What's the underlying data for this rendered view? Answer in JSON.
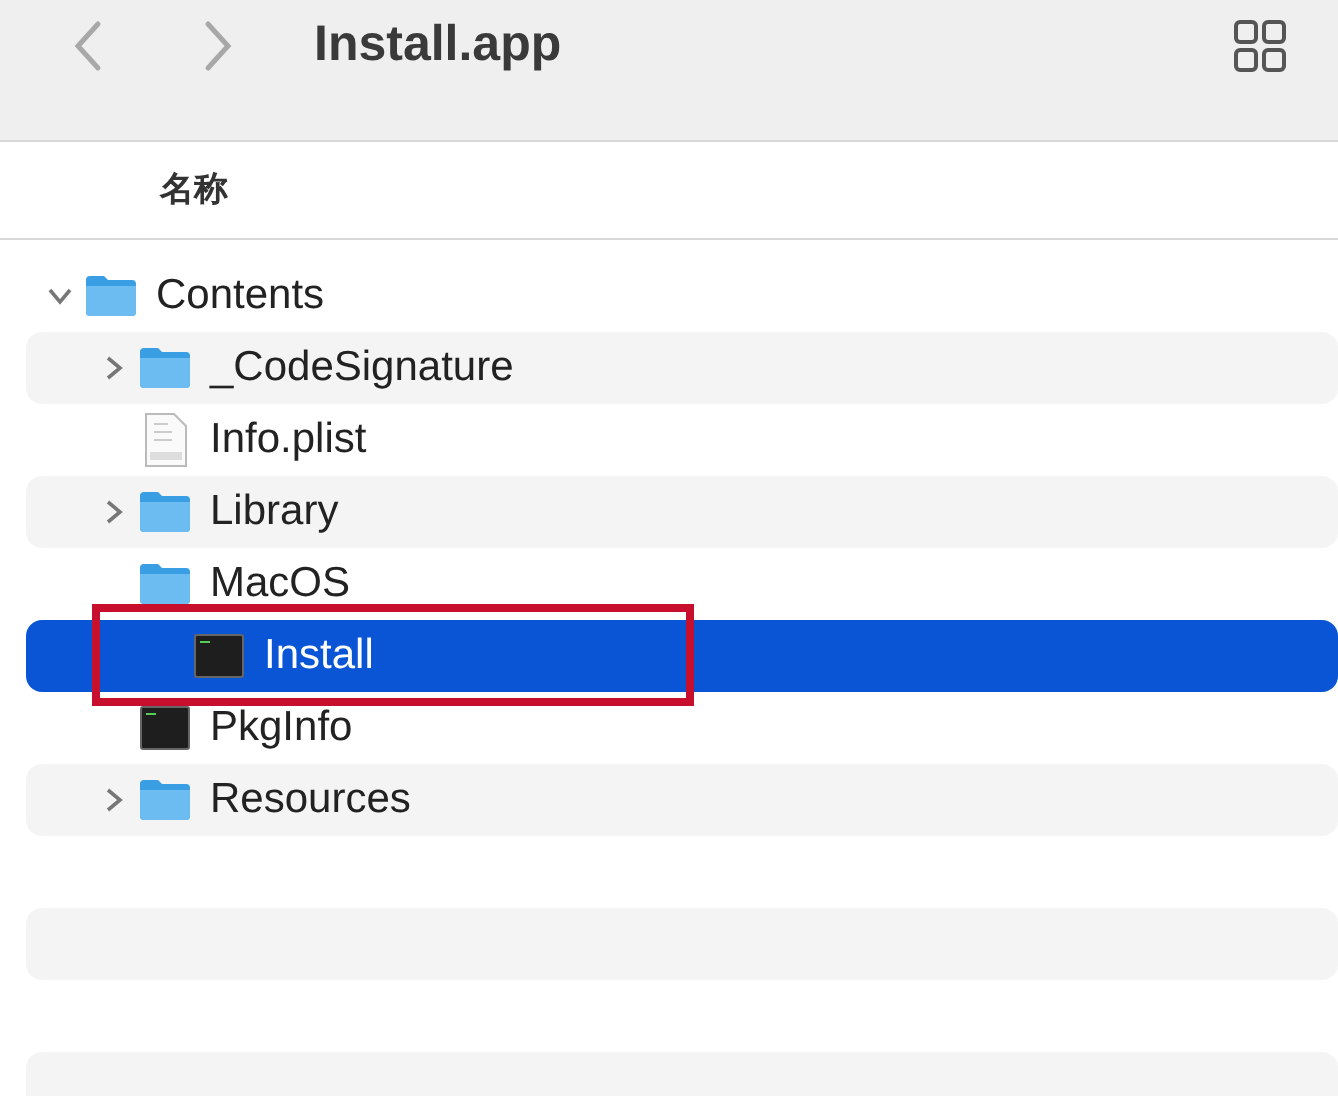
{
  "toolbar": {
    "title": "Install.app"
  },
  "column_header": "名称",
  "tree": [
    {
      "name": "Contents",
      "kind": "folder",
      "expanded": true,
      "selected": false,
      "children": [
        {
          "name": "_CodeSignature",
          "kind": "folder",
          "expanded": false,
          "selected": false
        },
        {
          "name": "Info.plist",
          "kind": "plist",
          "selected": false
        },
        {
          "name": "Library",
          "kind": "folder",
          "expanded": false,
          "selected": false
        },
        {
          "name": "MacOS",
          "kind": "folder",
          "expanded": true,
          "selected": false,
          "children": [
            {
              "name": "Install",
              "kind": "exec",
              "selected": true,
              "annotated": true
            }
          ]
        },
        {
          "name": "PkgInfo",
          "kind": "exec",
          "selected": false
        },
        {
          "name": "Resources",
          "kind": "folder",
          "expanded": false,
          "selected": false
        }
      ]
    }
  ]
}
